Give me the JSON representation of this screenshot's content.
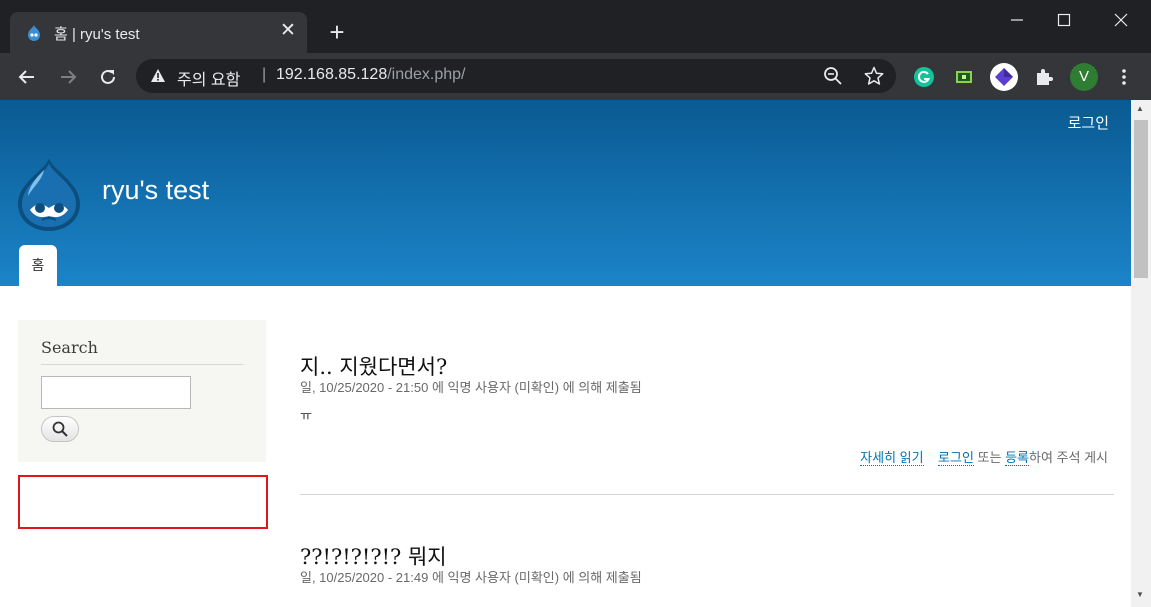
{
  "browser": {
    "tab_title": "홈 | ryu's test",
    "omnibox_warning": "주의 요함",
    "omnibox_separator": "|",
    "url_host": "192.168.85.128",
    "url_path": "/index.php/",
    "profile_initial": "V"
  },
  "site": {
    "login_link": "로그인",
    "name": "ryu's test",
    "home_tab": "홈"
  },
  "sidebar": {
    "search_title": "Search",
    "search_value": ""
  },
  "articles": [
    {
      "title": "지.. 지웠다면서?",
      "meta": "일, 10/25/2020 - 21:50 에 익명 사용자 (미확인) 에 의해 제출됨",
      "body": "ㅠ",
      "read_more": "자세히 읽기",
      "login": "로그인",
      "or": "또는",
      "register": "등록",
      "comment_suffix": "하여 주석 게시"
    },
    {
      "title": "??!?!?!?!? 뭐지",
      "meta": "일, 10/25/2020 - 21:49 에 익명 사용자 (미확인) 에 의해 제출됨"
    }
  ],
  "colors": {
    "header_top": "#0a5a92",
    "header_bottom": "#1b84c8",
    "link": "#0071b3",
    "highlight": "#e0161c"
  },
  "icons": [
    "drupal-favicon-icon",
    "close-icon",
    "plus-icon",
    "minimize-icon",
    "maximize-icon",
    "window-close-icon",
    "back-icon",
    "forward-icon",
    "reload-icon",
    "warning-icon",
    "zoom-icon",
    "star-icon",
    "grammarly-icon",
    "extension-green-icon",
    "extension-purple-icon",
    "puzzle-icon",
    "more-icon",
    "drupal-logo-icon",
    "magnifier-icon"
  ]
}
